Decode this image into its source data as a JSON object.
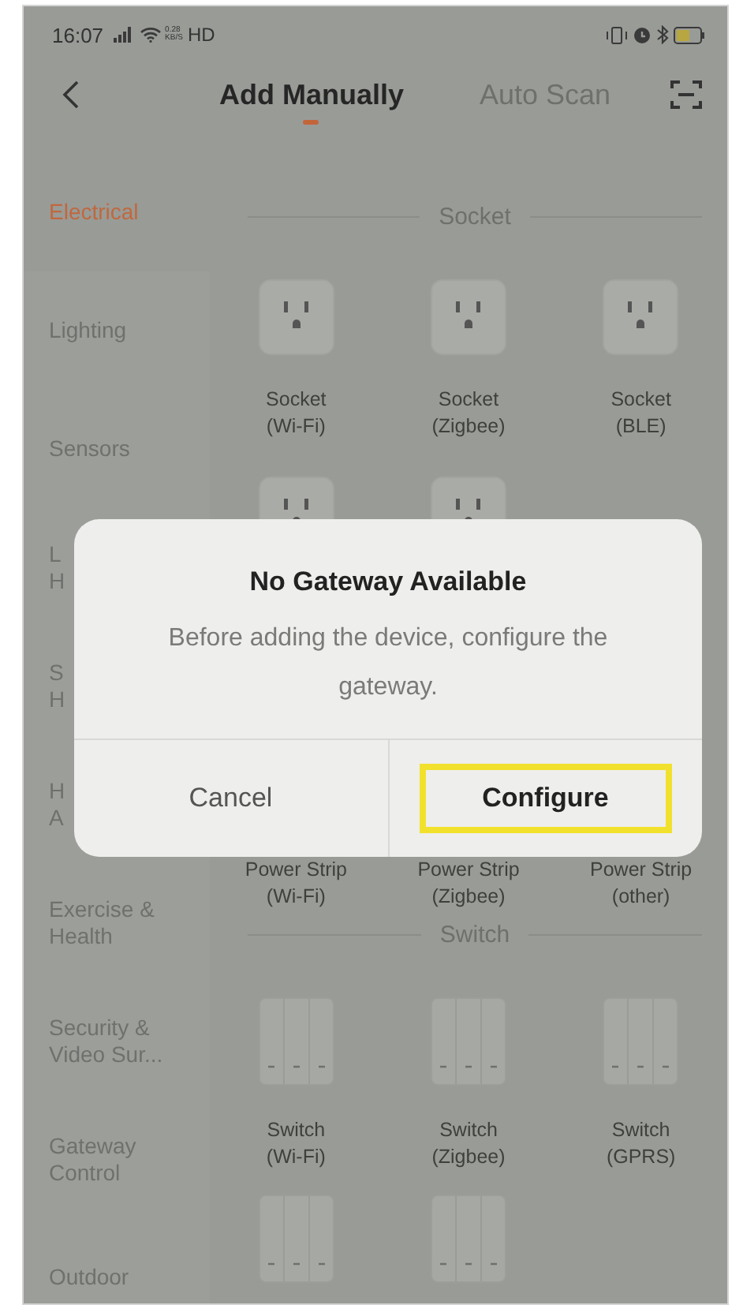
{
  "status_bar": {
    "time": "16:07",
    "network_speed": [
      "0.28",
      "KB/S"
    ],
    "network_type": "HD"
  },
  "nav": {
    "tabs": [
      {
        "label": "Add Manually",
        "selected": true
      },
      {
        "label": "Auto Scan",
        "selected": false
      }
    ]
  },
  "sidebar": {
    "items": [
      {
        "lines": [
          "Electrical"
        ],
        "selected": true
      },
      {
        "lines": [
          "Lighting"
        ],
        "selected": false
      },
      {
        "lines": [
          "Sensors"
        ],
        "selected": false
      },
      {
        "lines": [
          "L",
          "H"
        ],
        "selected": false
      },
      {
        "lines": [
          "S",
          "H"
        ],
        "selected": false
      },
      {
        "lines": [
          "H",
          "A"
        ],
        "selected": false
      },
      {
        "lines": [
          "Exercise &",
          "Health"
        ],
        "selected": false
      },
      {
        "lines": [
          "Security &",
          "Video Sur..."
        ],
        "selected": false
      },
      {
        "lines": [
          "Gateway",
          "Control"
        ],
        "selected": false
      },
      {
        "lines": [
          "Outdoor"
        ],
        "selected": false
      }
    ]
  },
  "sections": [
    {
      "title": "Socket",
      "rows": [
        [
          {
            "kind": "socket",
            "lines": [
              "Socket",
              "(Wi-Fi)"
            ]
          },
          {
            "kind": "socket",
            "lines": [
              "Socket",
              "(Zigbee)"
            ]
          },
          {
            "kind": "socket",
            "lines": [
              "Socket",
              "(BLE)"
            ]
          }
        ],
        [
          {
            "kind": "socket"
          },
          {
            "kind": "socket"
          }
        ]
      ]
    },
    {
      "rows": [
        [
          {
            "kind": "power_strip",
            "lines": [
              "Power Strip",
              "(Wi-Fi)"
            ]
          },
          {
            "kind": "power_strip",
            "lines": [
              "Power Strip",
              "(Zigbee)"
            ]
          },
          {
            "kind": "power_strip",
            "lines": [
              "Power Strip",
              "(other)"
            ]
          }
        ]
      ]
    },
    {
      "title": "Switch",
      "rows": [
        [
          {
            "kind": "switch",
            "lines": [
              "Switch",
              "(Wi-Fi)"
            ]
          },
          {
            "kind": "switch",
            "lines": [
              "Switch",
              "(Zigbee)"
            ]
          },
          {
            "kind": "switch",
            "lines": [
              "Switch",
              "(GPRS)"
            ]
          }
        ],
        [
          {
            "kind": "switch"
          },
          {
            "kind": "switch"
          }
        ]
      ]
    }
  ],
  "dialog": {
    "title": "No Gateway Available",
    "message": "Before adding the device, configure the gateway.",
    "buttons": [
      {
        "label": "Cancel",
        "primary": false,
        "highlighted": false
      },
      {
        "label": "Configure",
        "primary": true,
        "highlighted": true
      }
    ]
  }
}
